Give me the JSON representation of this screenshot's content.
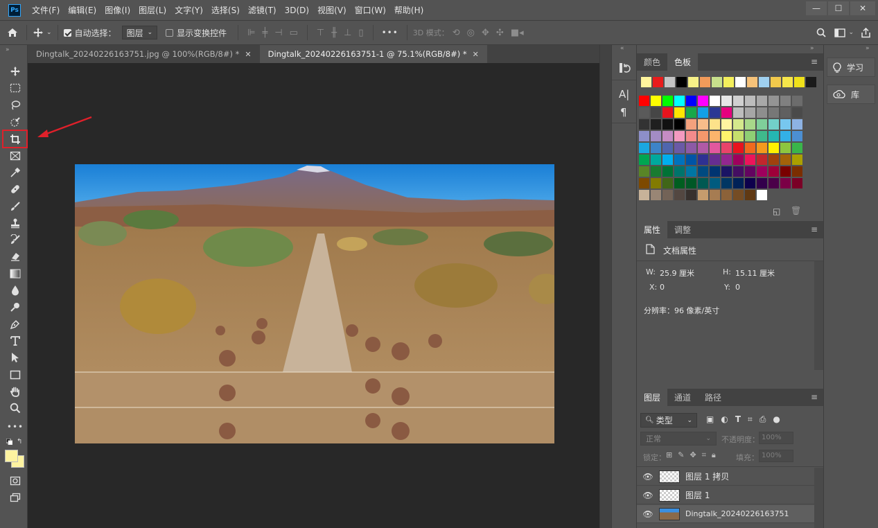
{
  "app": {
    "logo": "Ps"
  },
  "menu": [
    "文件(F)",
    "编辑(E)",
    "图像(I)",
    "图层(L)",
    "文字(Y)",
    "选择(S)",
    "滤镜(T)",
    "3D(D)",
    "视图(V)",
    "窗口(W)",
    "帮助(H)"
  ],
  "window": {
    "minimize": "—",
    "maximize": "☐",
    "close": "✕"
  },
  "options": {
    "auto_select_label": "自动选择：",
    "auto_select_value": "图层",
    "show_transform_label": "显示变换控件",
    "more": "•••",
    "mode_3d_label": "3D 模式："
  },
  "tabs": [
    {
      "label": "Dingtalk_20240226163751.jpg @ 100%(RGB/8#) *",
      "close": "✕"
    },
    {
      "label": "Dingtalk_20240226163751-1 @ 75.1%(RGB/8#) *",
      "close": "✕"
    }
  ],
  "panels": {
    "color_tabs": [
      "颜色",
      "色板"
    ],
    "props_tabs": [
      "属性",
      "调整"
    ],
    "doc_props_label": "文档属性",
    "w_label": "W:",
    "w_value": "25.9 厘米",
    "h_label": "H:",
    "h_value": "15.11 厘米",
    "x_label": "X:",
    "x_value": "0",
    "y_label": "Y:",
    "y_value": "0",
    "resolution": "分辨率：96 像素/英寸",
    "layers_tabs": [
      "图层",
      "通道",
      "路径"
    ],
    "kind_filter": "类型",
    "blend_mode": "正常",
    "opacity_label": "不透明度：",
    "opacity_value": "100%",
    "lock_label": "锁定：",
    "fill_label": "填充：",
    "fill_value": "100%",
    "layers": [
      "图层 1 拷贝",
      "图层 1",
      "Dingtalk_20240226163751"
    ]
  },
  "side": {
    "learn": "学习",
    "library": "库"
  },
  "colors": {
    "fg_swatch": "#fdf3a0",
    "bg_swatch": "#fdf3a0",
    "highlight": "#e0202a",
    "accent": "#31a8ff"
  }
}
